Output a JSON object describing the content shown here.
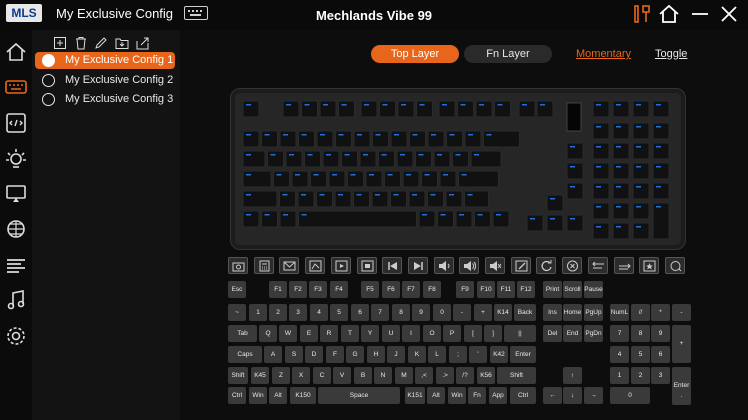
{
  "app": {
    "logo": "MLS",
    "config_title": "My Exclusive Config",
    "device_title": "Mechlands Vibe 99"
  },
  "configs": [
    {
      "label": "My Exclusive Config 1",
      "active": true
    },
    {
      "label": "My Exclusive Config 2",
      "active": false
    },
    {
      "label": "My Exclusive Config 3",
      "active": false
    }
  ],
  "layers": {
    "top_label": "Top Layer",
    "fn_label": "Fn Layer",
    "momentary_label": "Momentary",
    "toggle_label": "Toggle"
  },
  "colors": {
    "accent": "#e8661b",
    "background": "#0d0d0d",
    "key": "#3a3a3a",
    "key_legend": "#1e6fd9"
  },
  "function_icons": [
    "camera-icon",
    "calculator-icon",
    "mail-icon",
    "browser-icon",
    "media-player-icon",
    "stop-icon",
    "previous-track-icon",
    "next-track-icon",
    "volume-down-icon",
    "volume-up-icon",
    "mute-icon",
    "brush-icon",
    "refresh-icon",
    "cancel-icon",
    "move-left-icon",
    "move-right-icon",
    "favorite-icon",
    "search-icon"
  ],
  "keys": {
    "esc": "Esc",
    "f1": "F1",
    "f2": "F2",
    "f3": "F3",
    "f4": "F4",
    "f5": "F5",
    "f6": "F6",
    "f7": "F7",
    "f8": "F8",
    "f9": "F9",
    "f10": "F10",
    "f11": "F11",
    "f12": "F12",
    "print": "Print",
    "scroll": "Scroll",
    "pause": "Pause",
    "tilde": "~",
    "n1": "1",
    "n2": "2",
    "n3": "3",
    "n4": "4",
    "n5": "5",
    "n6": "6",
    "n7": "7",
    "n8": "8",
    "n9": "9",
    "n0": "0",
    "minus": "-",
    "plus": "+",
    "k14": "K14",
    "back": "Back",
    "ins": "Ins",
    "home": "Home",
    "pgup": "PgUp",
    "numl": "NumL",
    "np_slash": "//",
    "np_star": "*",
    "np_minus": "-",
    "tab": "Tab",
    "q": "Q",
    "w": "W",
    "e": "E",
    "r": "R",
    "t": "T",
    "y": "Y",
    "u": "U",
    "i": "I",
    "o": "O",
    "p": "P",
    "lbracket": "[",
    "rbracket": "]",
    "pipe": "||",
    "del": "Del",
    "end": "End",
    "pgdn": "PgDn",
    "np7": "7",
    "np8": "8",
    "np9": "9",
    "np_plus": "+",
    "caps": "Caps",
    "a": "A",
    "s": "S",
    "d": "D",
    "f": "F",
    "g": "G",
    "h": "H",
    "j": "J",
    "k": "K",
    "l": "L",
    "semicolon": ";",
    "quote": "'",
    "k42": "K42",
    "enter": "Enter",
    "np4": "4",
    "np5": "5",
    "np6": "6",
    "lshift": "Shift",
    "k45": "K45",
    "z": "Z",
    "x": "X",
    "c": "C",
    "v": "V",
    "b": "B",
    "n": "N",
    "m": "M",
    "comma": ",<",
    "period": ".>",
    "slash": "/?",
    "k56": "K56",
    "rshift": "Shift",
    "up": "↑",
    "np1": "1",
    "np2": "2",
    "np3": "3",
    "np_enter": "Enter",
    "lctrl": "Ctrl",
    "lwin": "Win",
    "lalt": "Alt",
    "k150": "K150",
    "space": "Space",
    "k151": "K151",
    "ralt": "Alt",
    "rwin": "Win",
    "fn": "Fn",
    "app": "App",
    "rctrl": "Ctrl",
    "left": "←",
    "down": "↓",
    "right": "→",
    "np0": "0",
    "np_dot": "."
  }
}
